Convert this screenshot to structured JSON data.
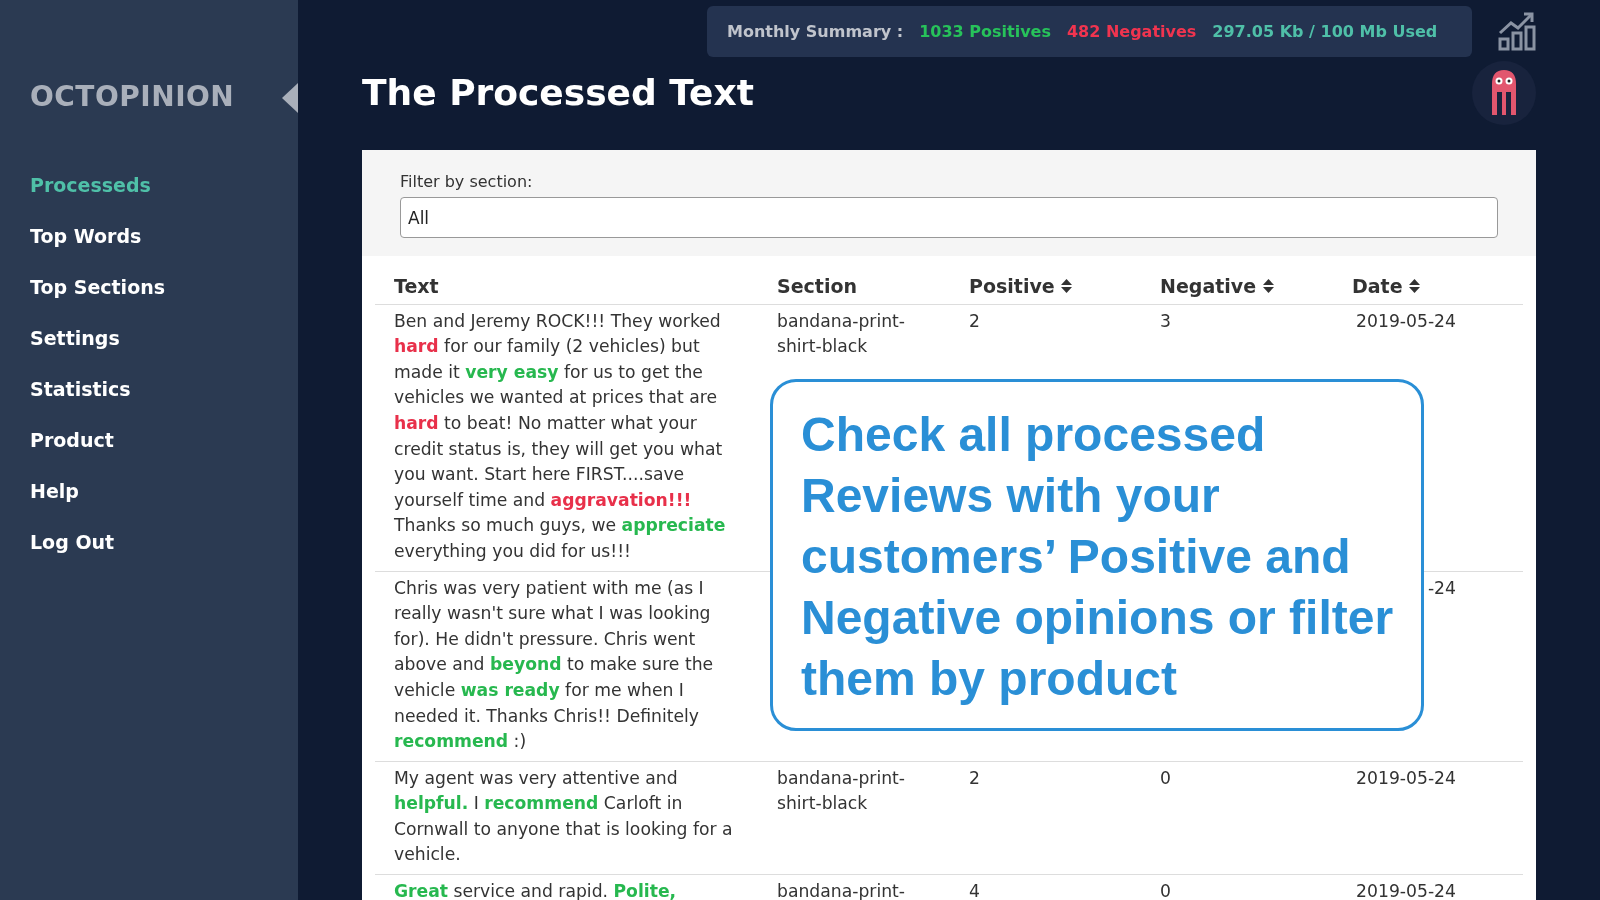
{
  "sidebar": {
    "logo": "OCTOPINION",
    "items": [
      {
        "label": "Processeds",
        "selected": true
      },
      {
        "label": "Top Words",
        "selected": false
      },
      {
        "label": "Top Sections",
        "selected": false
      },
      {
        "label": "Settings",
        "selected": false
      },
      {
        "label": "Statistics",
        "selected": false
      },
      {
        "label": "Product",
        "selected": false
      },
      {
        "label": "Help",
        "selected": false
      },
      {
        "label": "Log Out",
        "selected": false
      }
    ]
  },
  "summary": {
    "label": "Monthly Summary :",
    "positives": "1033 Positives",
    "negatives": "482 Negatives",
    "usage": "297.05 Kb / 100 Mb Used"
  },
  "page_title": "The Processed Text",
  "filter": {
    "label": "Filter by section:",
    "value": "All"
  },
  "table": {
    "columns": [
      {
        "label": "Text",
        "sortable": false
      },
      {
        "label": "Section",
        "sortable": false
      },
      {
        "label": "Positive",
        "sortable": true
      },
      {
        "label": "Negative",
        "sortable": true
      },
      {
        "label": "Date",
        "sortable": true
      }
    ],
    "rows": [
      {
        "text": [
          {
            "t": "Ben and Jeremy ROCK!!! They worked ",
            "kind": "neutral"
          },
          {
            "t": "hard",
            "kind": "negative"
          },
          {
            "t": " for our family (2 vehicles) but made it ",
            "kind": "neutral"
          },
          {
            "t": "very easy",
            "kind": "positive"
          },
          {
            "t": " for us to get the vehicles we wanted at prices that are ",
            "kind": "neutral"
          },
          {
            "t": "hard",
            "kind": "negative"
          },
          {
            "t": " to beat! No matter what your credit status is, they will get you what you want. Start here FIRST....save yourself time and ",
            "kind": "neutral"
          },
          {
            "t": "aggravation!!!",
            "kind": "negative"
          },
          {
            "t": " Thanks so much guys, we ",
            "kind": "neutral"
          },
          {
            "t": "appreciate",
            "kind": "positive"
          },
          {
            "t": " everything you did for us!!!",
            "kind": "neutral"
          }
        ],
        "section": "bandana-print-shirt-black",
        "positive": "2",
        "negative": "3",
        "date": "2019-05-24"
      },
      {
        "text": [
          {
            "t": "Chris was very patient with me (as I really wasn't sure what I was looking for). He didn't pressure. Chris went above and ",
            "kind": "neutral"
          },
          {
            "t": "beyond",
            "kind": "positive"
          },
          {
            "t": " to make sure the vehicle ",
            "kind": "neutral"
          },
          {
            "t": "was ready",
            "kind": "positive"
          },
          {
            "t": " for me when I needed it. Thanks Chris!! Definitely ",
            "kind": "neutral"
          },
          {
            "t": "recommend",
            "kind": "positive"
          },
          {
            "t": " :)",
            "kind": "neutral"
          }
        ],
        "date": "-24"
      },
      {
        "text": [
          {
            "t": "My agent was very attentive and ",
            "kind": "neutral"
          },
          {
            "t": "helpful.",
            "kind": "positive"
          },
          {
            "t": " I ",
            "kind": "neutral"
          },
          {
            "t": "recommend",
            "kind": "positive"
          },
          {
            "t": " Carloft in Cornwall to anyone that is looking for a vehicle.",
            "kind": "neutral"
          }
        ],
        "section": "bandana-print-shirt-black",
        "positive": "2",
        "negative": "0",
        "date": "2019-05-24"
      },
      {
        "text": [
          {
            "t": "Great",
            "kind": "positive"
          },
          {
            "t": " service and rapid. ",
            "kind": "neutral"
          },
          {
            "t": "Polite,",
            "kind": "positive"
          }
        ],
        "section": "bandana-print-",
        "positive": "4",
        "negative": "0",
        "date": "2019-05-24"
      }
    ]
  },
  "callout": {
    "text": "Check all processed Reviews with your customers’ Positive and Negative opinions or filter them by product"
  }
}
